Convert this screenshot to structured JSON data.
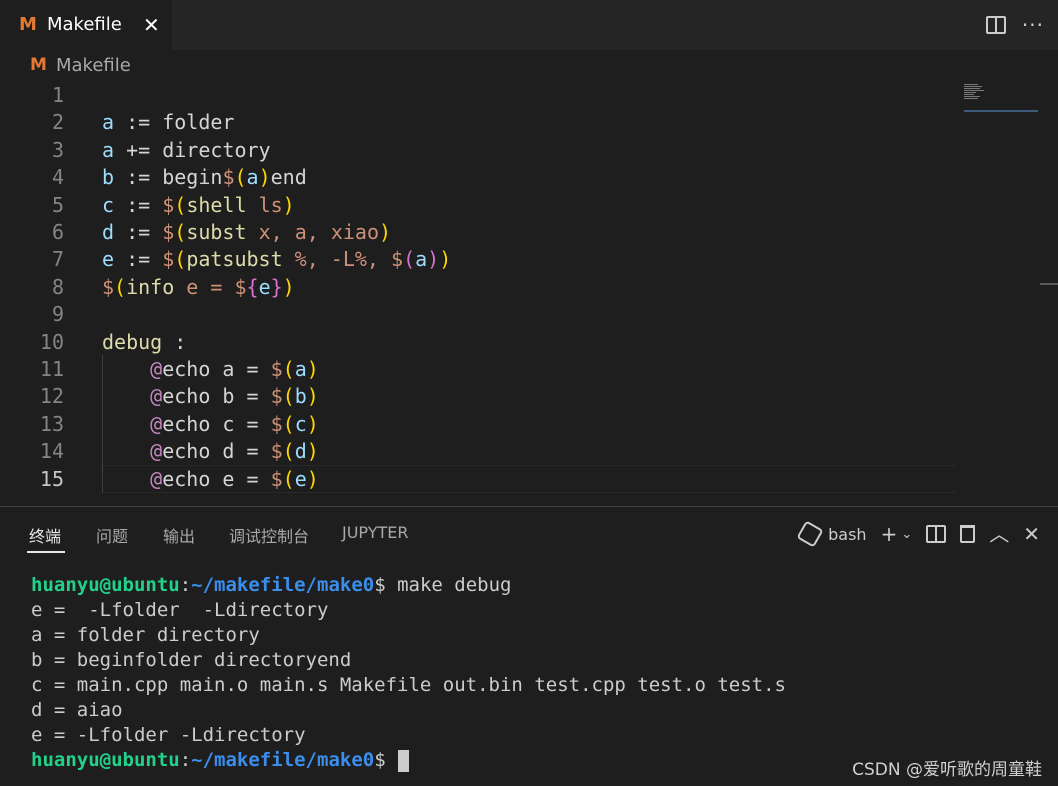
{
  "tab": {
    "label": "Makefile",
    "logo": "M",
    "close": "✕"
  },
  "tab_actions": {
    "split_icon": "split-editor-icon",
    "more": "···"
  },
  "breadcrumb": {
    "logo": "M",
    "label": "Makefile"
  },
  "editor": {
    "active_line": 15,
    "lines": [
      {
        "n": "1",
        "tokens": []
      },
      {
        "n": "2",
        "tokens": [
          [
            "var",
            "a"
          ],
          [
            "op",
            " := "
          ],
          [
            "txt",
            "folder"
          ]
        ]
      },
      {
        "n": "3",
        "tokens": [
          [
            "var",
            "a"
          ],
          [
            "op",
            " += "
          ],
          [
            "txt",
            "directory"
          ]
        ]
      },
      {
        "n": "4",
        "tokens": [
          [
            "var",
            "b"
          ],
          [
            "op",
            " := "
          ],
          [
            "txt",
            "begin"
          ],
          [
            "str",
            "$"
          ],
          [
            "b1",
            "("
          ],
          [
            "var",
            "a"
          ],
          [
            "b1",
            ")"
          ],
          [
            "txt",
            "end"
          ]
        ]
      },
      {
        "n": "5",
        "tokens": [
          [
            "var",
            "c"
          ],
          [
            "op",
            " := "
          ],
          [
            "str",
            "$"
          ],
          [
            "b1",
            "("
          ],
          [
            "fn",
            "shell"
          ],
          [
            "str",
            " ls"
          ],
          [
            "b1",
            ")"
          ]
        ]
      },
      {
        "n": "6",
        "tokens": [
          [
            "var",
            "d"
          ],
          [
            "op",
            " := "
          ],
          [
            "str",
            "$"
          ],
          [
            "b1",
            "("
          ],
          [
            "fn",
            "subst"
          ],
          [
            "str",
            " x, a, xiao"
          ],
          [
            "b1",
            ")"
          ]
        ]
      },
      {
        "n": "7",
        "tokens": [
          [
            "var",
            "e"
          ],
          [
            "op",
            " := "
          ],
          [
            "str",
            "$"
          ],
          [
            "b1",
            "("
          ],
          [
            "fn",
            "patsubst"
          ],
          [
            "str",
            " %, -L%, "
          ],
          [
            "str",
            "$"
          ],
          [
            "b2",
            "("
          ],
          [
            "var",
            "a"
          ],
          [
            "b2",
            ")"
          ],
          [
            "b1",
            ")"
          ]
        ]
      },
      {
        "n": "8",
        "tokens": [
          [
            "str",
            "$"
          ],
          [
            "b1",
            "("
          ],
          [
            "fn",
            "info"
          ],
          [
            "str",
            " e = "
          ],
          [
            "str",
            "$"
          ],
          [
            "b2",
            "{"
          ],
          [
            "var",
            "e"
          ],
          [
            "b2",
            "}"
          ],
          [
            "b1",
            ")"
          ]
        ]
      },
      {
        "n": "9",
        "tokens": []
      },
      {
        "n": "10",
        "tokens": [
          [
            "fn",
            "debug"
          ],
          [
            "op",
            " :"
          ]
        ]
      },
      {
        "n": "11",
        "tokens": [
          [
            "txt",
            "    "
          ],
          [
            "at",
            "@"
          ],
          [
            "txt",
            "echo a = "
          ],
          [
            "str",
            "$"
          ],
          [
            "b1",
            "("
          ],
          [
            "var",
            "a"
          ],
          [
            "b1",
            ")"
          ]
        ]
      },
      {
        "n": "12",
        "tokens": [
          [
            "txt",
            "    "
          ],
          [
            "at",
            "@"
          ],
          [
            "txt",
            "echo b = "
          ],
          [
            "str",
            "$"
          ],
          [
            "b1",
            "("
          ],
          [
            "var",
            "b"
          ],
          [
            "b1",
            ")"
          ]
        ]
      },
      {
        "n": "13",
        "tokens": [
          [
            "txt",
            "    "
          ],
          [
            "at",
            "@"
          ],
          [
            "txt",
            "echo c = "
          ],
          [
            "str",
            "$"
          ],
          [
            "b1",
            "("
          ],
          [
            "var",
            "c"
          ],
          [
            "b1",
            ")"
          ]
        ]
      },
      {
        "n": "14",
        "tokens": [
          [
            "txt",
            "    "
          ],
          [
            "at",
            "@"
          ],
          [
            "txt",
            "echo d = "
          ],
          [
            "str",
            "$"
          ],
          [
            "b1",
            "("
          ],
          [
            "var",
            "d"
          ],
          [
            "b1",
            ")"
          ]
        ]
      },
      {
        "n": "15",
        "tokens": [
          [
            "txt",
            "    "
          ],
          [
            "at",
            "@"
          ],
          [
            "txt",
            "echo e = "
          ],
          [
            "str",
            "$"
          ],
          [
            "b1",
            "("
          ],
          [
            "var",
            "e"
          ],
          [
            "b1",
            ")"
          ]
        ]
      }
    ]
  },
  "panel": {
    "tabs": [
      "终端",
      "问题",
      "输出",
      "调试控制台",
      "JUPYTER"
    ],
    "active_tab": 0,
    "shell_label": "bash",
    "icons": {
      "add": "+",
      "dropdown": "⌄",
      "maximize": "︿",
      "close": "✕"
    }
  },
  "terminal": {
    "user": "huanyu@ubuntu",
    "path": "~/makefile/make0",
    "prompt_suffix": "$ ",
    "command": "make debug",
    "output": [
      "e =  -Lfolder  -Ldirectory",
      "a = folder directory",
      "b = beginfolder directoryend",
      "c = main.cpp main.o main.s Makefile out.bin test.cpp test.o test.s",
      "d = aiao",
      "e = -Lfolder -Ldirectory"
    ],
    "final_prompt_suffix": "$"
  },
  "watermark": "CSDN @爱听歌的周童鞋"
}
